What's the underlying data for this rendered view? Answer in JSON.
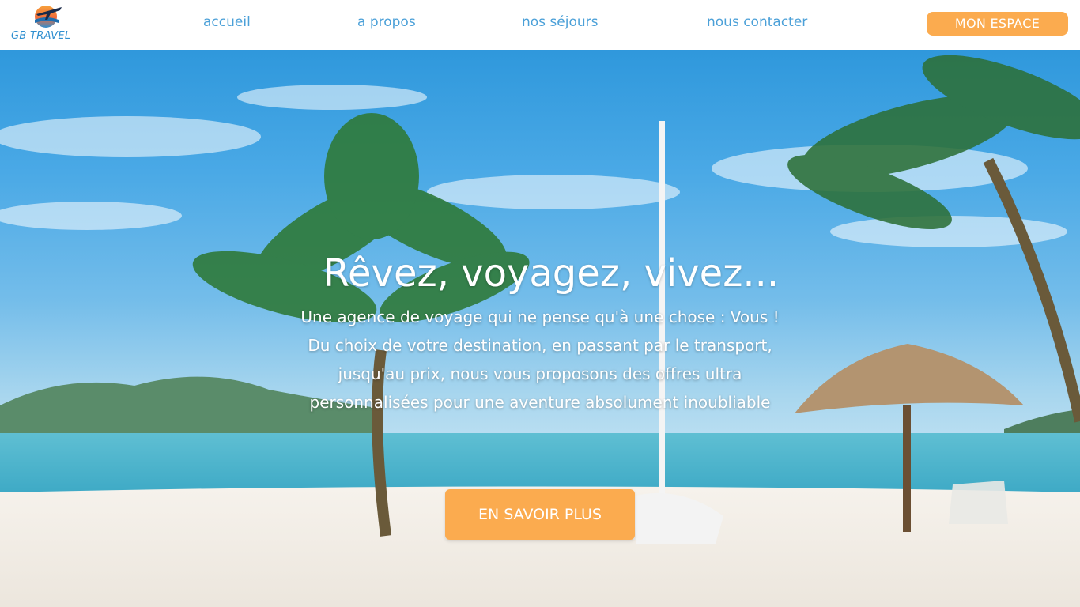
{
  "brand": {
    "name": "GB TRAVEL",
    "logo_icon": "plane-sunset-icon"
  },
  "nav": {
    "links": [
      "accueil",
      "a propos",
      "nos séjours",
      "nous contacter"
    ],
    "account_button": "MON ESPACE"
  },
  "hero": {
    "title": "Rêvez, voyagez, vivez...",
    "tagline": "Une agence de voyage qui ne pense qu'à une chose : Vous !",
    "description": "Du choix de votre destination, en passant par le transport, jusqu'au prix, nous vous proposons des offres ultra personnalisées pour une aventure absolument inoubliable",
    "cta": "EN SAVOIR PLUS",
    "background": "tropical-beach-image"
  },
  "colors": {
    "accent": "#fbab4f",
    "nav_link": "#4ba0d8",
    "logo_text": "#2f8fd0",
    "hero_text": "#ffffff"
  }
}
